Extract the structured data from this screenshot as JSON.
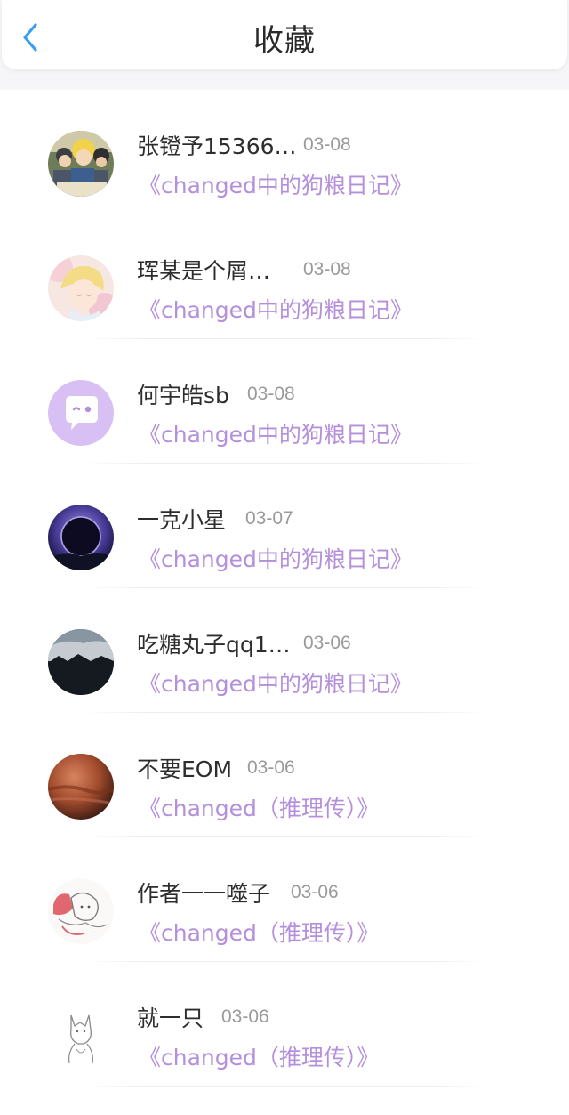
{
  "header": {
    "title": "收藏",
    "back_icon": "chevron-left-icon",
    "accent_color": "#3a9ef0"
  },
  "book_color": "#b48fdb",
  "favorites": [
    {
      "name": "张镫予15366…",
      "date": "03-08",
      "book": "《changed中的狗粮日记》",
      "avatar": "anime-group-avatar"
    },
    {
      "name": "珲某是个屑…",
      "date": "03-08",
      "book": "《changed中的狗粮日记》",
      "avatar": "anime-blonde-avatar"
    },
    {
      "name": "何宇皓sb",
      "date": "03-08",
      "book": "《changed中的狗粮日记》",
      "avatar": "chat-bubble-avatar"
    },
    {
      "name": "一克小星",
      "date": "03-07",
      "book": "《changed中的狗粮日记》",
      "avatar": "eclipse-avatar"
    },
    {
      "name": "吃糖丸子qq1…",
      "date": "03-06",
      "book": "《changed中的狗粮日记》",
      "avatar": "landscape-avatar"
    },
    {
      "name": "不要EOM",
      "date": "03-06",
      "book": "《changed（推理传）》",
      "avatar": "planet-avatar"
    },
    {
      "name": "作者一一噬子",
      "date": "03-06",
      "book": "《changed（推理传）》",
      "avatar": "sketch-avatar"
    },
    {
      "name": "就一只",
      "date": "03-06",
      "book": "《changed（推理传）》",
      "avatar": "wolf-sketch-avatar"
    }
  ]
}
